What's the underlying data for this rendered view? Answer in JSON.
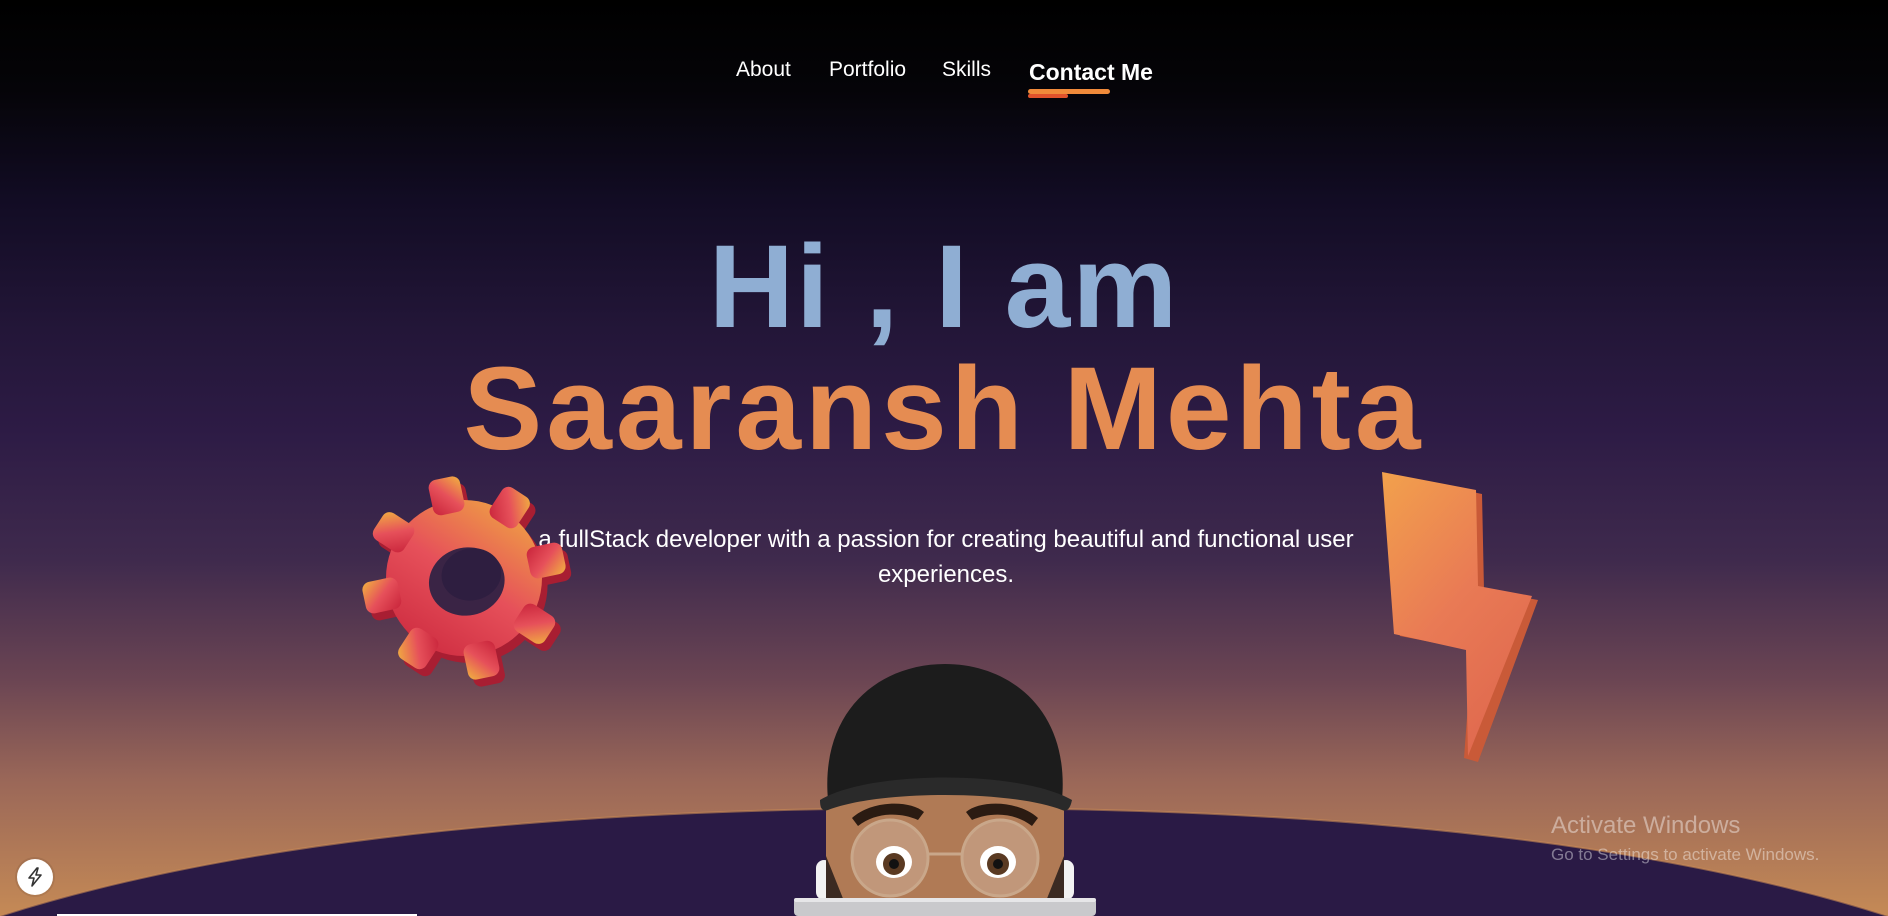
{
  "nav": {
    "items": [
      {
        "label": "About"
      },
      {
        "label": "Portfolio"
      },
      {
        "label": "Skills"
      },
      {
        "label": "Contact Me",
        "active": true
      }
    ]
  },
  "hero": {
    "greeting": "Hi , I am",
    "name": "Saaransh Mehta",
    "tagline": "a fullStack developer with a passion for creating beautiful and functional user experiences."
  },
  "decorations": {
    "left_icon": "gear-icon",
    "right_icon": "lightning-bolt-icon",
    "avatar": "memoji-avatar"
  },
  "watermark": {
    "title": "Activate Windows",
    "subtitle": "Go to Settings to activate Windows."
  },
  "badge": {
    "icon": "bolt-icon"
  },
  "colors": {
    "greeting": "#8faed3",
    "name": "#e58c52",
    "accent": "#f08a3a",
    "planet": "#2a1a45"
  }
}
